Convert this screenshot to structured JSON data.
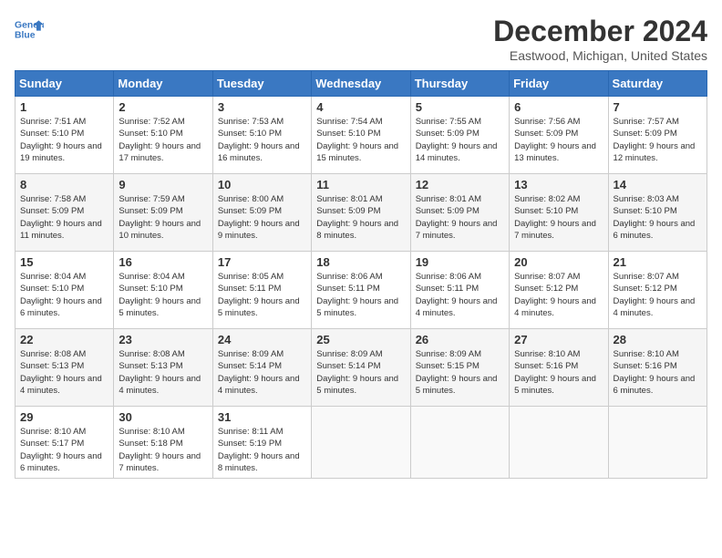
{
  "header": {
    "logo_line1": "General",
    "logo_line2": "Blue",
    "title": "December 2024",
    "subtitle": "Eastwood, Michigan, United States"
  },
  "days_of_week": [
    "Sunday",
    "Monday",
    "Tuesday",
    "Wednesday",
    "Thursday",
    "Friday",
    "Saturday"
  ],
  "weeks": [
    [
      {
        "day": 1,
        "rise": "7:51 AM",
        "set": "5:10 PM",
        "hours": "9 hours and 19 minutes."
      },
      {
        "day": 2,
        "rise": "7:52 AM",
        "set": "5:10 PM",
        "hours": "9 hours and 17 minutes."
      },
      {
        "day": 3,
        "rise": "7:53 AM",
        "set": "5:10 PM",
        "hours": "9 hours and 16 minutes."
      },
      {
        "day": 4,
        "rise": "7:54 AM",
        "set": "5:10 PM",
        "hours": "9 hours and 15 minutes."
      },
      {
        "day": 5,
        "rise": "7:55 AM",
        "set": "5:09 PM",
        "hours": "9 hours and 14 minutes."
      },
      {
        "day": 6,
        "rise": "7:56 AM",
        "set": "5:09 PM",
        "hours": "9 hours and 13 minutes."
      },
      {
        "day": 7,
        "rise": "7:57 AM",
        "set": "5:09 PM",
        "hours": "9 hours and 12 minutes."
      }
    ],
    [
      {
        "day": 8,
        "rise": "7:58 AM",
        "set": "5:09 PM",
        "hours": "9 hours and 11 minutes."
      },
      {
        "day": 9,
        "rise": "7:59 AM",
        "set": "5:09 PM",
        "hours": "9 hours and 10 minutes."
      },
      {
        "day": 10,
        "rise": "8:00 AM",
        "set": "5:09 PM",
        "hours": "9 hours and 9 minutes."
      },
      {
        "day": 11,
        "rise": "8:01 AM",
        "set": "5:09 PM",
        "hours": "9 hours and 8 minutes."
      },
      {
        "day": 12,
        "rise": "8:01 AM",
        "set": "5:09 PM",
        "hours": "9 hours and 7 minutes."
      },
      {
        "day": 13,
        "rise": "8:02 AM",
        "set": "5:10 PM",
        "hours": "9 hours and 7 minutes."
      },
      {
        "day": 14,
        "rise": "8:03 AM",
        "set": "5:10 PM",
        "hours": "9 hours and 6 minutes."
      }
    ],
    [
      {
        "day": 15,
        "rise": "8:04 AM",
        "set": "5:10 PM",
        "hours": "9 hours and 6 minutes."
      },
      {
        "day": 16,
        "rise": "8:04 AM",
        "set": "5:10 PM",
        "hours": "9 hours and 5 minutes."
      },
      {
        "day": 17,
        "rise": "8:05 AM",
        "set": "5:11 PM",
        "hours": "9 hours and 5 minutes."
      },
      {
        "day": 18,
        "rise": "8:06 AM",
        "set": "5:11 PM",
        "hours": "9 hours and 5 minutes."
      },
      {
        "day": 19,
        "rise": "8:06 AM",
        "set": "5:11 PM",
        "hours": "9 hours and 4 minutes."
      },
      {
        "day": 20,
        "rise": "8:07 AM",
        "set": "5:12 PM",
        "hours": "9 hours and 4 minutes."
      },
      {
        "day": 21,
        "rise": "8:07 AM",
        "set": "5:12 PM",
        "hours": "9 hours and 4 minutes."
      }
    ],
    [
      {
        "day": 22,
        "rise": "8:08 AM",
        "set": "5:13 PM",
        "hours": "9 hours and 4 minutes."
      },
      {
        "day": 23,
        "rise": "8:08 AM",
        "set": "5:13 PM",
        "hours": "9 hours and 4 minutes."
      },
      {
        "day": 24,
        "rise": "8:09 AM",
        "set": "5:14 PM",
        "hours": "9 hours and 4 minutes."
      },
      {
        "day": 25,
        "rise": "8:09 AM",
        "set": "5:14 PM",
        "hours": "9 hours and 5 minutes."
      },
      {
        "day": 26,
        "rise": "8:09 AM",
        "set": "5:15 PM",
        "hours": "9 hours and 5 minutes."
      },
      {
        "day": 27,
        "rise": "8:10 AM",
        "set": "5:16 PM",
        "hours": "9 hours and 5 minutes."
      },
      {
        "day": 28,
        "rise": "8:10 AM",
        "set": "5:16 PM",
        "hours": "9 hours and 6 minutes."
      }
    ],
    [
      {
        "day": 29,
        "rise": "8:10 AM",
        "set": "5:17 PM",
        "hours": "9 hours and 6 minutes."
      },
      {
        "day": 30,
        "rise": "8:10 AM",
        "set": "5:18 PM",
        "hours": "9 hours and 7 minutes."
      },
      {
        "day": 31,
        "rise": "8:11 AM",
        "set": "5:19 PM",
        "hours": "9 hours and 8 minutes."
      },
      null,
      null,
      null,
      null
    ]
  ],
  "labels": {
    "sunrise": "Sunrise:",
    "sunset": "Sunset:",
    "daylight": "Daylight:"
  }
}
